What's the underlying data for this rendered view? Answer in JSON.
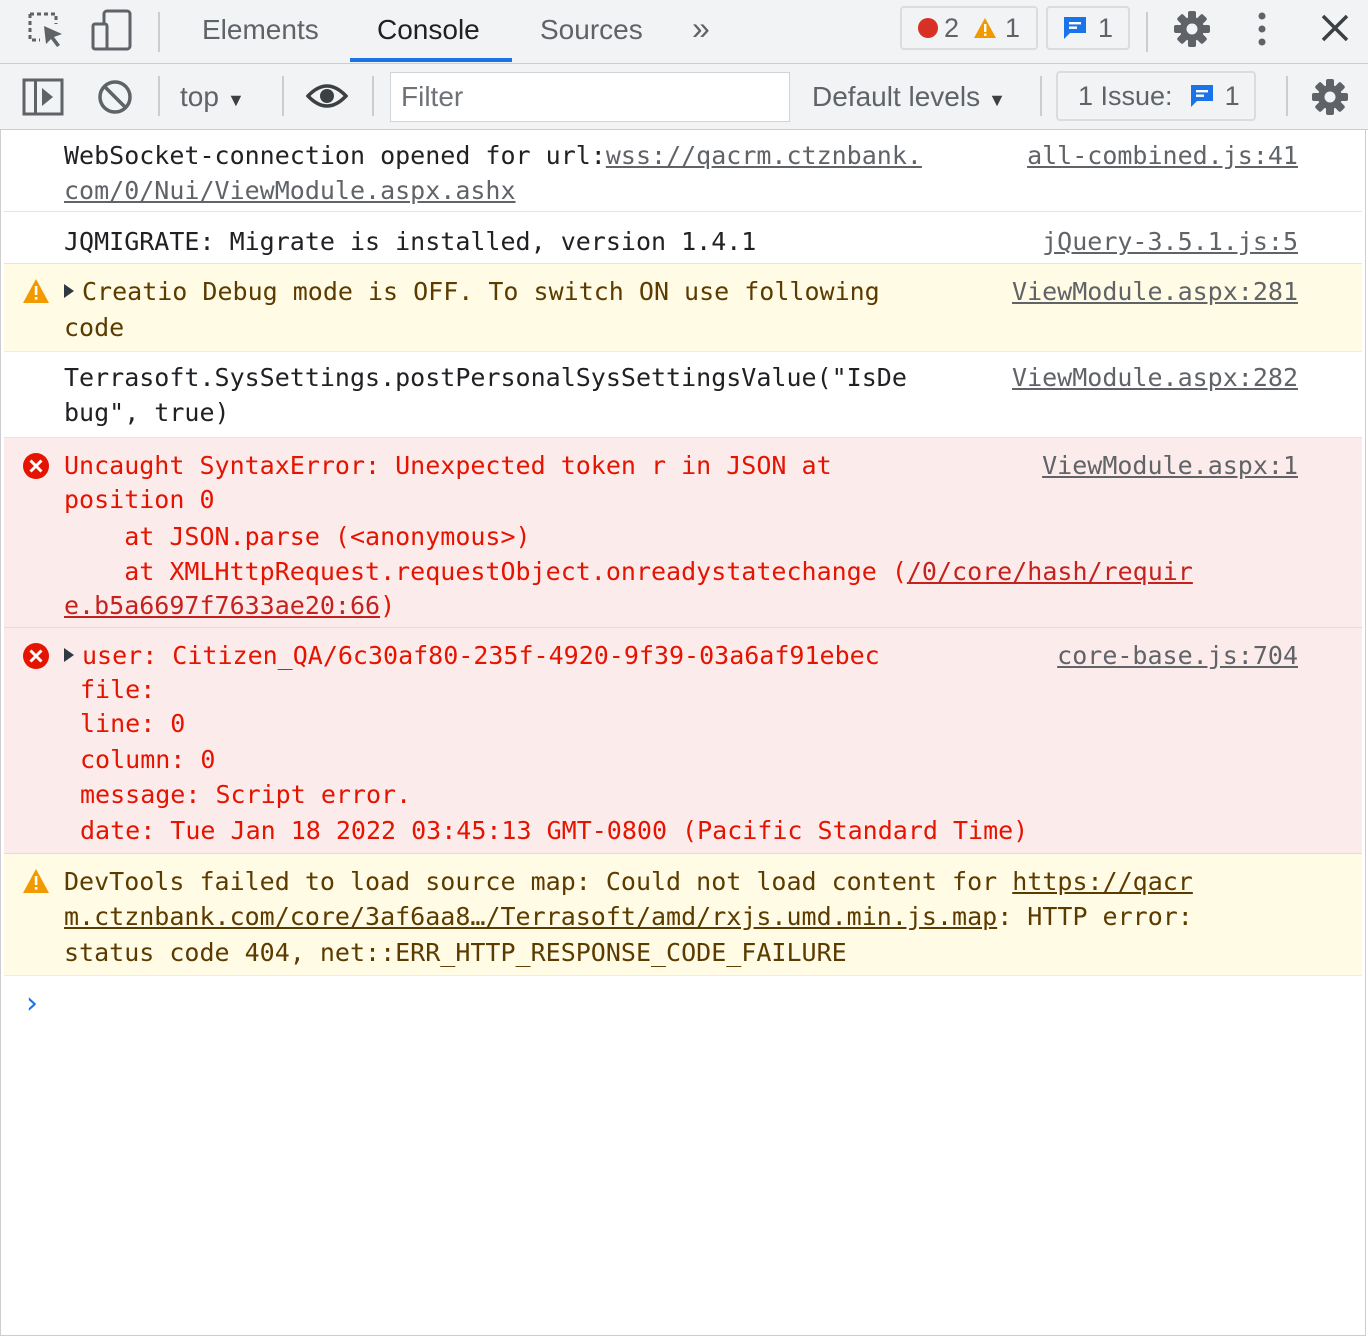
{
  "tabs": {
    "elements": "Elements",
    "console": "Console",
    "sources": "Sources",
    "more": "»"
  },
  "counters": {
    "errors": "2",
    "warnings": "1",
    "messages": "1"
  },
  "toolbar": {
    "context": "top",
    "filter_placeholder": "Filter",
    "levels": "Default levels",
    "issues_label": "1 Issue:",
    "issues_count": "1"
  },
  "messages": {
    "websocket": {
      "line1": "WebSocket-connection opened for url:",
      "link_a": "wss://qacrm.ctznbank.",
      "link_b": "com/0/Nui/ViewModule.aspx.ashx",
      "source": "all-combined.js:41"
    },
    "jqmigrate": {
      "text": "JQMIGRATE: Migrate is installed, version 1.4.1",
      "source": "jQuery-3.5.1.js:5"
    },
    "debug_warning": {
      "line1": "Creatio Debug mode is OFF. To switch ON use following",
      "line2": "code",
      "source": "ViewModule.aspx:281"
    },
    "terrasoft": {
      "line1": "Terrasoft.SysSettings.postPersonalSysSettingsValue(\"IsDe",
      "line2": "bug\", true)",
      "source": "ViewModule.aspx:282"
    },
    "syntax_error": {
      "line1": "Uncaught SyntaxError: Unexpected token r in JSON at",
      "line2": "position 0",
      "line3": "    at JSON.parse (<anonymous>)",
      "line4_prefix": "    at XMLHttpRequest.requestObject.onreadystatechange (",
      "line4_link": "/0/core/hash/requir",
      "line5_link": "e.b5a6697f7633ae20:66",
      "line5_suffix": ")",
      "source": "ViewModule.aspx:1"
    },
    "user_error": {
      "line1": "user: Citizen_QA/6c30af80-235f-4920-9f39-03a6af91ebec",
      "line2": "file:",
      "line3": "line: 0",
      "line4": "column: 0",
      "line5": "message: Script error.",
      "line6": "date: Tue Jan 18 2022 03:45:13 GMT-0800 (Pacific Standard Time)",
      "source": "core-base.js:704"
    },
    "sourcemap_warning": {
      "line1_prefix": "DevTools failed to load source map: Could not load content for ",
      "line1_link": "https://qacr",
      "line2_link": "m.ctznbank.com/core/3af6aa8…/Terrasoft/amd/rxjs.umd.min.js.map",
      "line2_suffix": ": HTTP error:",
      "line3": "status code 404, net::ERR_HTTP_RESPONSE_CODE_FAILURE"
    }
  },
  "prompt_symbol": "›"
}
